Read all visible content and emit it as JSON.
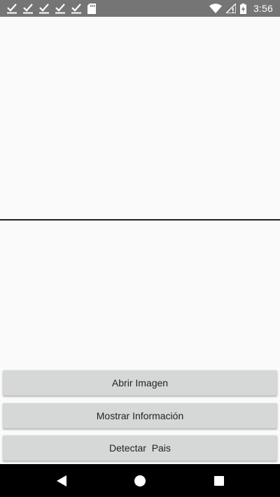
{
  "status_bar": {
    "time": "3:56",
    "notification_icons": [
      "check-icon",
      "check-icon",
      "check-icon",
      "check-icon",
      "check-icon",
      "sd-card-icon"
    ],
    "system_icons": [
      "wifi-icon",
      "no-signal-icon",
      "battery-charging-icon"
    ]
  },
  "buttons": {
    "open_image": "Abrir Imagen",
    "show_info": "Mostrar Información",
    "detect_country": "Detectar  Pais"
  },
  "nav_bar": {
    "icons": [
      "back-icon",
      "home-icon",
      "recents-icon"
    ]
  }
}
